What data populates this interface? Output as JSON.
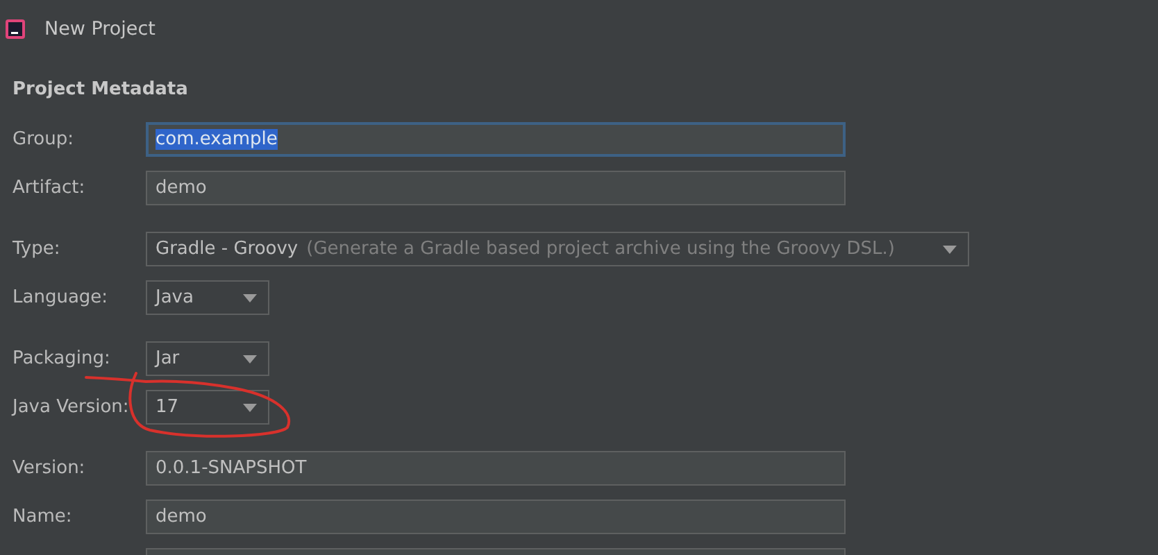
{
  "window": {
    "title": "New Project"
  },
  "section_title": "Project Metadata",
  "groups": [
    [
      {
        "kind": "text",
        "label": "Group:",
        "value": "com.example",
        "focused": true,
        "text_selected": true
      },
      {
        "kind": "text",
        "label": "Artifact:",
        "value": "demo",
        "focused": false,
        "text_selected": false
      }
    ],
    [
      {
        "kind": "select",
        "label": "Type:",
        "value": "Gradle - Groovy",
        "hint": "(Generate a Gradle based project archive using the Groovy DSL.)"
      },
      {
        "kind": "select",
        "label": "Language:",
        "value": "Java"
      }
    ],
    [
      {
        "kind": "select",
        "label": "Packaging:",
        "value": "Jar"
      },
      {
        "kind": "select",
        "label": "Java Version:",
        "value": "17",
        "annotated": true
      }
    ],
    [
      {
        "kind": "text",
        "label": "Version:",
        "value": "0.0.1-SNAPSHOT",
        "focused": false,
        "text_selected": false
      },
      {
        "kind": "text",
        "label": "Name:",
        "value": "demo",
        "focused": false,
        "text_selected": false
      },
      {
        "kind": "text"
      }
    ]
  ]
}
